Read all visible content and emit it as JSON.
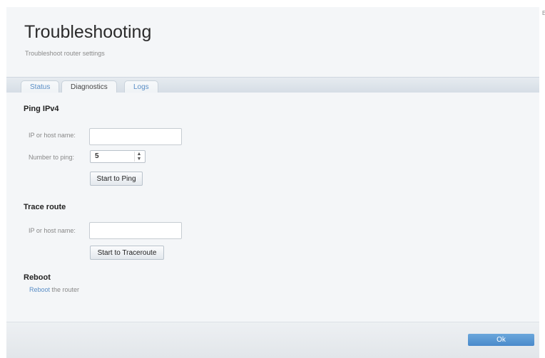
{
  "header": {
    "title": "Troubleshooting",
    "subtitle": "Troubleshoot router settings",
    "corner_mark": "E"
  },
  "tabs": [
    {
      "label": "Status"
    },
    {
      "label": "Diagnostics",
      "active": true
    },
    {
      "label": "Logs"
    }
  ],
  "ping": {
    "heading": "Ping IPv4",
    "host_label": "IP or host name:",
    "host_value": "",
    "count_label": "Number to ping:",
    "count_value": "5",
    "start_button": "Start to Ping"
  },
  "trace": {
    "heading": "Trace route",
    "host_label": "IP or host name:",
    "host_value": "",
    "start_button": "Start to Traceroute"
  },
  "reboot": {
    "heading": "Reboot",
    "link": "Reboot",
    "text": " the router"
  },
  "footer": {
    "ok_label": "Ok"
  },
  "colors": {
    "accent": "#5a8ec6",
    "ok_button": "#4a8acb"
  }
}
